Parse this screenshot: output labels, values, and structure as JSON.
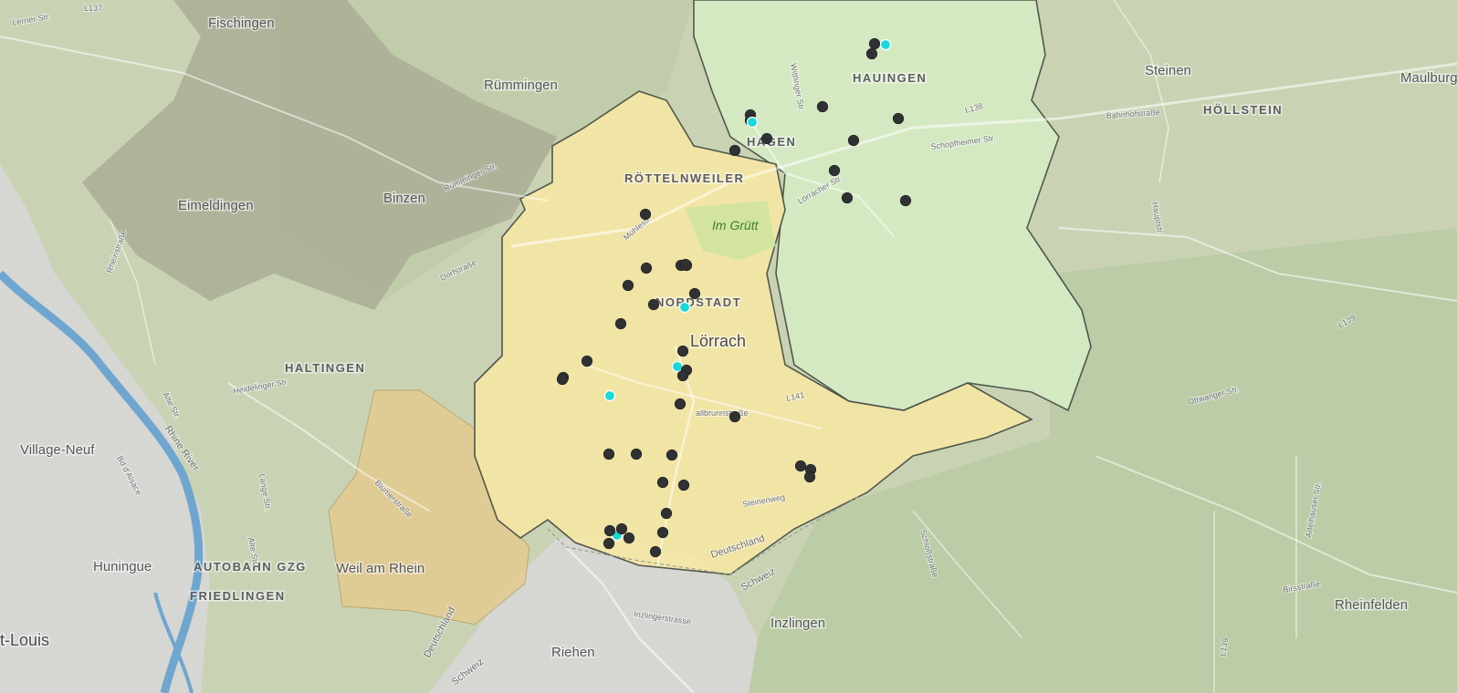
{
  "map": {
    "labels": {
      "fischingen": "Fischingen",
      "ruemmingen": "Rümmingen",
      "eimeldingen": "Eimeldingen",
      "binzen": "Binzen",
      "haltingen": "HALTINGEN",
      "village_neuf": "Village-Neuf",
      "huningue": "Huningue",
      "st_louis": "t-Louis",
      "weil": "Weil am Rhein",
      "autobahn": "AUTOBAHN GZG",
      "friedlingen": "FRIEDLINGEN",
      "riehen": "Riehen",
      "inzlingen": "Inzlingen",
      "rheinfelden": "Rheinfelden",
      "loerrach": "Lörrach",
      "nordstadt": "NORDSTADT",
      "roettelnweiler": "RÖTTELNWEILER",
      "im_gruett": "Im Grütt",
      "hagen": "HAGEN",
      "hauingen": "HAUINGEN",
      "steinen": "Steinen",
      "hoellstein": "HÖLLSTEIN",
      "maulburg": "Maulburg",
      "deutschland_1": "Deutschland",
      "deutschland_2": "Deutschland",
      "schweiz_1": "Schweiz",
      "schweiz_2": "Schweiz",
      "rhine": "Rhine River",
      "street_bd_alsace": "Bd d'Alsace",
      "street_alte": "Alte Str.",
      "street_alte2": "Alte Str.",
      "street_heideluger": "Heidelinger Str.",
      "street_rheinstrasse": "Rheinstraße",
      "street_dorfstrasse": "Dorfstraße",
      "street_ruemminger": "Rümminger Str.",
      "street_l137": "L137",
      "street_lerner": "Lerner Str.",
      "street_muehlestr": "Mühlestr.",
      "street_wittlinger": "Wittlinger Str.",
      "street_l138": "L138",
      "street_schopfheimer": "Schopfheimer Str.",
      "street_loerracher": "Lörracher Str.",
      "street_bahnhofstrasse": "Bahnhofstraße",
      "street_l141": "L141",
      "street_wallbrunnstrasse": "allbrunnstraße",
      "street_steinenweg": "Steinenweg",
      "street_inzlinger": "Inzlingerstrasse",
      "street_schlossstrasse": "Schloßstraße",
      "street_ottwanger": "Ottwanger Str.",
      "street_l139": "L139",
      "street_l139b": "L139",
      "street_adelhauser": "Adelhauser Str.",
      "street_birsstrasse": "Birsstraße",
      "street_bluemerstrasse": "Blümerstraße",
      "street_lange": "Lange Str.",
      "street_hauptstr": "Hauptstr.",
      "street_l141b": "L141"
    },
    "colors": {
      "base": "#c9d3b4",
      "city_gray": "#d6d6d3",
      "water": "#6fa6cf",
      "loerrach_zone": "#f4e7a6",
      "weil_zone": "#e7c98a",
      "hauingen_zone": "#d5ebc3",
      "dark_region": "#a7ab93",
      "marker_dark": "#2f3133",
      "marker_cyan": "#19d9d6"
    },
    "markers": [
      {
        "type": "dark"
      },
      {
        "type": "dark"
      },
      {
        "type": "cyan"
      },
      {
        "type": "dark"
      },
      {
        "type": "dark"
      },
      {
        "type": "cyan"
      },
      {
        "type": "dark"
      },
      {
        "type": "dark"
      },
      {
        "type": "dark"
      },
      {
        "type": "dark"
      },
      {
        "type": "dark"
      },
      {
        "type": "dark"
      },
      {
        "type": "dark"
      },
      {
        "type": "dark"
      },
      {
        "type": "dark"
      },
      {
        "type": "dark"
      },
      {
        "type": "dark"
      },
      {
        "type": "dark"
      },
      {
        "type": "dark"
      },
      {
        "type": "dark"
      },
      {
        "type": "dark"
      },
      {
        "type": "cyan"
      },
      {
        "type": "dark"
      },
      {
        "type": "dark"
      },
      {
        "type": "dark"
      },
      {
        "type": "cyan"
      },
      {
        "type": "dark"
      },
      {
        "type": "dark"
      },
      {
        "type": "dark"
      },
      {
        "type": "cyan"
      },
      {
        "type": "dark"
      },
      {
        "type": "dark"
      },
      {
        "type": "dark"
      },
      {
        "type": "dark"
      },
      {
        "type": "dark"
      },
      {
        "type": "dark"
      },
      {
        "type": "dark"
      },
      {
        "type": "dark"
      },
      {
        "type": "dark"
      },
      {
        "type": "dark"
      },
      {
        "type": "dark"
      },
      {
        "type": "cyan"
      },
      {
        "type": "dark"
      },
      {
        "type": "dark"
      },
      {
        "type": "dark"
      },
      {
        "type": "dark"
      },
      {
        "type": "dark"
      },
      {
        "type": "dark"
      },
      {
        "type": "dark"
      },
      {
        "type": "dark"
      }
    ]
  }
}
